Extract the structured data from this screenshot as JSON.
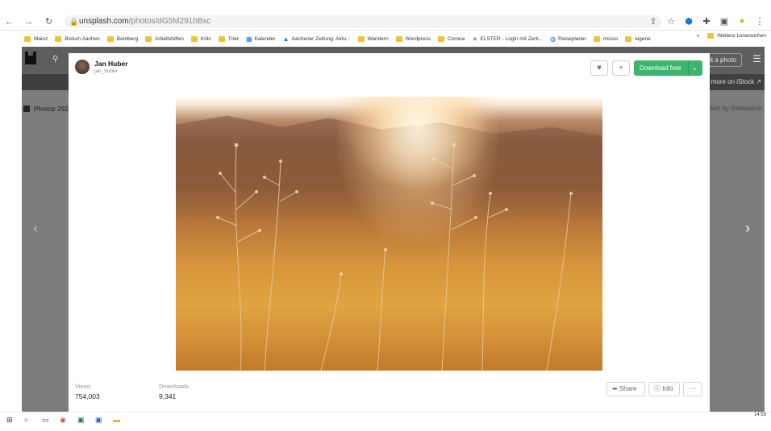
{
  "browser": {
    "url_host": "unsplash.com",
    "url_path": "/photos/dG5M291hBxc"
  },
  "bookmarks": [
    "Mainz",
    "Bistum Aachen",
    "Bamberg",
    "Arbeitshilfen",
    "Köln",
    "Trier",
    "Kalender",
    "Aachener Zeitung: Aktu...",
    "Wandern",
    "Wordpress",
    "Corona",
    "ELSTER - Login mit Zerti...",
    "Reiseplaner",
    "missio",
    "eigene"
  ],
  "bookmarks_more": "»",
  "bookmarks_other": "Weitere Lesezeichen",
  "background_page": {
    "submit_label": "Submit a photo",
    "banner_text": "more on iStock ↗",
    "photos_tab_label": "Photos 292",
    "sort_label": "Sort by Relevance"
  },
  "modal": {
    "author_name": "Jan Huber",
    "author_handle": "jan_huber",
    "download_label": "Download free",
    "views_label": "Views",
    "views_value": "754,003",
    "downloads_label": "Downloads",
    "downloads_value": "9,341",
    "share_label": "Share",
    "info_label": "Info",
    "more_label": "···"
  },
  "taskbar": {
    "clock": "14:53"
  },
  "colors": {
    "download_green": "#3cb46e",
    "overlay_grey": "#7c7c7c"
  }
}
